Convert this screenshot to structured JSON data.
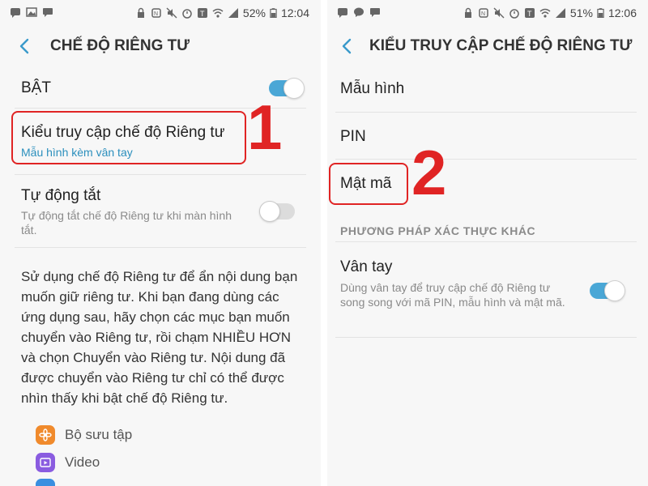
{
  "left": {
    "status": {
      "battery": "52%",
      "time": "12:04"
    },
    "title": "CHẾ ĐỘ RIÊNG TƯ",
    "master_toggle": {
      "label": "BẬT",
      "on": true
    },
    "access_type": {
      "title": "Kiểu truy cập chế độ Riêng tư",
      "subtitle": "Mẫu hình kèm vân tay"
    },
    "auto_off": {
      "title": "Tự động tắt",
      "subtitle": "Tự động tắt chế độ Riêng tư khi màn hình tắt.",
      "on": false
    },
    "description": "Sử dụng chế độ Riêng tư để ẩn nội dung bạn muốn giữ riêng tư. Khi bạn đang dùng các ứng dụng sau, hãy chọn các mục bạn muốn chuyển vào Riêng tư, rồi chạm NHIỀU HƠN và chọn Chuyển vào Riêng tư. Nội dung đã được chuyển vào Riêng tư chỉ có thể được nhìn thấy khi bật chế độ Riêng tư.",
    "apps": [
      {
        "label": "Bộ sưu tập",
        "icon": "gallery-icon",
        "color": "#f08a2c"
      },
      {
        "label": "Video",
        "icon": "video-icon",
        "color": "#8a5ce0"
      }
    ],
    "step": "1"
  },
  "right": {
    "status": {
      "battery": "51%",
      "time": "12:06"
    },
    "title": "KIỂU TRUY CẬP CHẾ ĐỘ RIÊNG TƯ",
    "options": [
      "Mẫu hình",
      "PIN",
      "Mật mã"
    ],
    "section_header": "PHƯƠNG PHÁP XÁC THỰC KHÁC",
    "fingerprint": {
      "title": "Vân tay",
      "subtitle": "Dùng vân tay để truy cập chế độ Riêng tư song song với mã PIN, mẫu hình và mật mã.",
      "on": true
    },
    "step": "2"
  },
  "colors": {
    "accent": "#4aa7d6",
    "highlight": "#e02424",
    "link": "#2b8fbd"
  }
}
